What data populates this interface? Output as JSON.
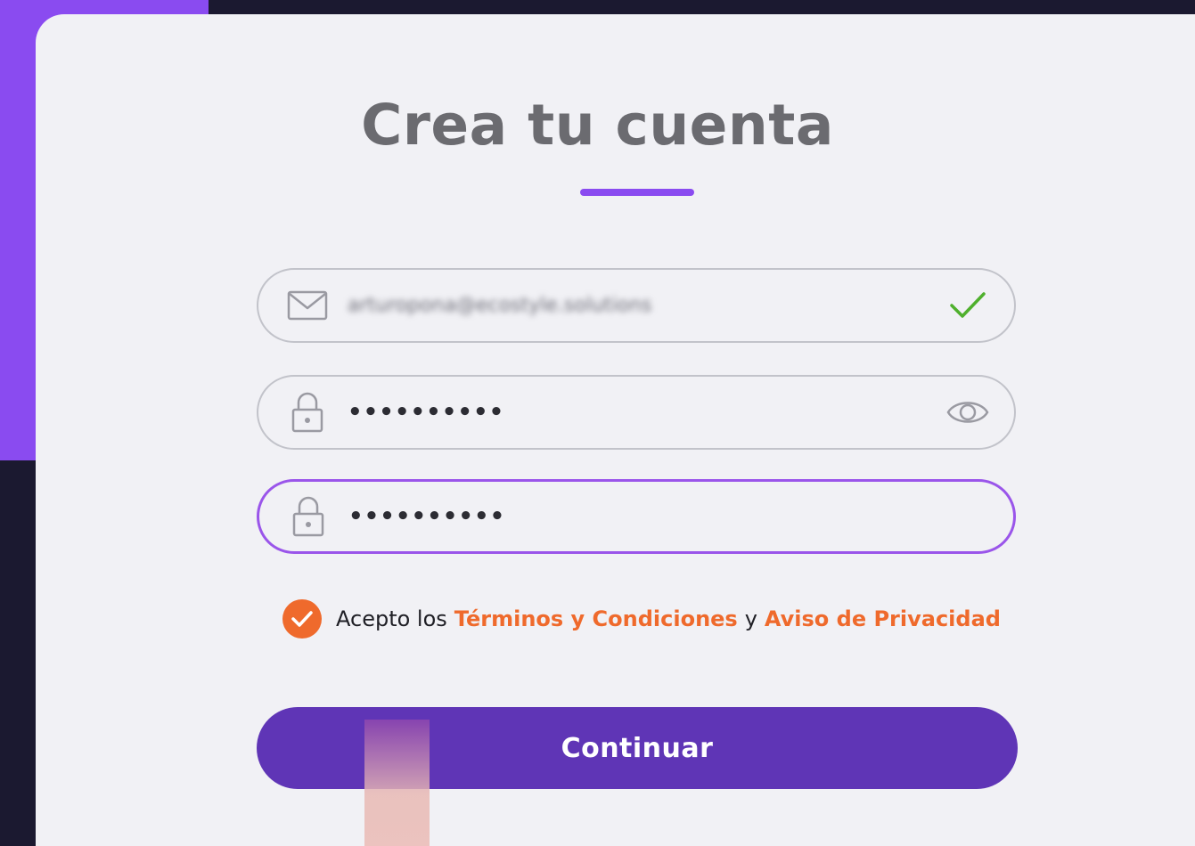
{
  "title": "Crea tu cuenta",
  "colors": {
    "accent": "#8a4bf0",
    "primary_button": "#5f35b6",
    "link": "#ef6a2c",
    "success": "#4fb02d"
  },
  "form": {
    "email": {
      "icon": "mail-icon",
      "value": "arturopona@ecostyle.solutions",
      "status_icon": "checkmark-icon"
    },
    "password": {
      "icon": "lock-icon",
      "value": "••••••••••",
      "toggle_icon": "eye-icon"
    },
    "confirm_password": {
      "icon": "lock-icon",
      "value": "••••••••••"
    }
  },
  "terms": {
    "checked": true,
    "prefix": "Acepto los",
    "terms_link": "Términos y Condiciones",
    "conjunction": "y",
    "privacy_link": "Aviso de Privacidad"
  },
  "continue_label": "Continuar"
}
